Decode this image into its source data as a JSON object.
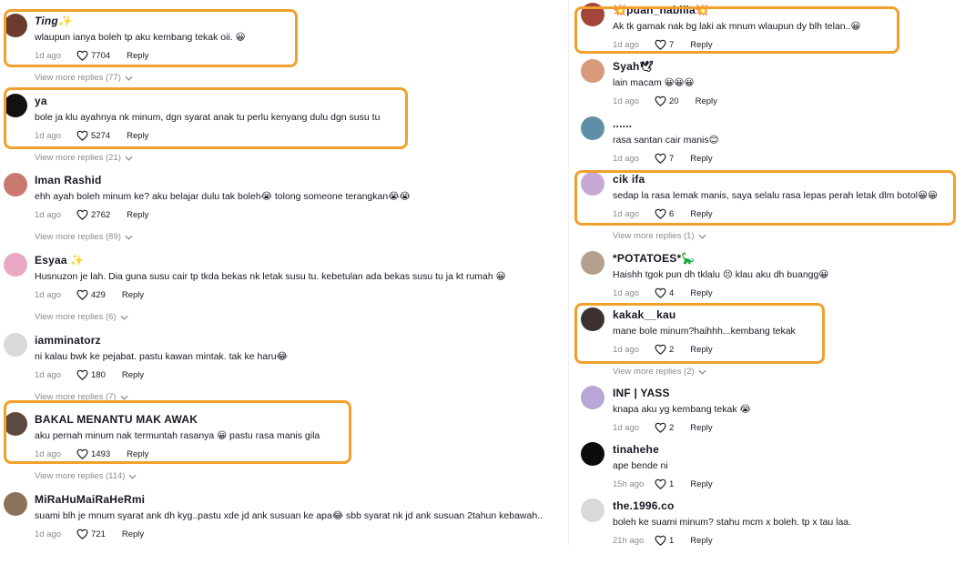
{
  "left": [
    {
      "user": "Ting✨",
      "text": "wlaupun ianya boleh tp aku kembang tekak oii. 😀",
      "time": "1d ago",
      "likes": "7704",
      "reply": "Reply",
      "more": "View more replies (77)",
      "av": "#6b3b2e"
    },
    {
      "user": "ya",
      "text": "bole ja klu ayahnya nk minum, dgn syarat anak tu perlu kenyang dulu dgn susu tu",
      "time": "1d ago",
      "likes": "5274",
      "reply": "Reply",
      "more": "View more replies (21)",
      "av": "#111111"
    },
    {
      "user": "Iman Rashid",
      "text": "ehh ayah boleh minum ke? aku belajar dulu tak boleh😭 tolong someone terangkan😭😭",
      "time": "1d ago",
      "likes": "2762",
      "reply": "Reply",
      "more": "View more replies (89)",
      "av": "#c9796f"
    },
    {
      "user": "Esyaa ✨",
      "text": "Husnuzon je lah. Dia guna susu cair tp tkda bekas nk letak susu tu. kebetulan ada bekas susu tu ja kt rumah 😀",
      "time": "1d ago",
      "likes": "429",
      "reply": "Reply",
      "more": "View more replies (6)",
      "av": "#e9a9c4"
    },
    {
      "user": "iamminatorz",
      "text": "ni kalau bwk ke pejabat. pastu kawan mintak. tak ke haru😂",
      "time": "1d ago",
      "likes": "180",
      "reply": "Reply",
      "more": "View more replies (7)",
      "av": "#d9d9db"
    },
    {
      "user": "BAKAL MENANTU MAK AWAK",
      "text": "aku pernah minum nak termuntah rasanya 😀 pastu rasa manis gila",
      "time": "1d ago",
      "likes": "1493",
      "reply": "Reply",
      "more": "View more replies (114)",
      "av": "#5a4a3f"
    },
    {
      "user": "MiRaHuMaiRaHeRmi",
      "text": "suami blh je mnum syarat ank dh kyg..pastu xde jd ank susuan ke apa😂 sbb syarat nk jd ank susuan 2tahun kebawah..",
      "time": "1d ago",
      "likes": "721",
      "reply": "Reply",
      "more": "",
      "av": "#8a7358"
    }
  ],
  "right": [
    {
      "user": "💥puan_nabilla💥",
      "text": "Ak tk gamak nak bg laki ak mnum wlaupun dy blh telan..😀",
      "time": "1d ago",
      "likes": "7",
      "reply": "Reply",
      "more": "",
      "av": "#a4453a"
    },
    {
      "user": "Syah🕊",
      "text": "lain macam 😀😀😀",
      "time": "1d ago",
      "likes": "20",
      "reply": "Reply",
      "more": "",
      "av": "#d79a7a"
    },
    {
      "user": "......",
      "text": "rasa santan cair manis😊",
      "time": "1d ago",
      "likes": "7",
      "reply": "Reply",
      "more": "",
      "av": "#5f8fa8"
    },
    {
      "user": "cik ifa",
      "text": "sedap la rasa lemak manis, saya selalu rasa lepas perah letak dlm botol😀😀",
      "time": "1d ago",
      "likes": "6",
      "reply": "Reply",
      "more": "View more replies (1)",
      "av": "#c7a9d8"
    },
    {
      "user": "*POTATOES*🦕",
      "text": "Haishh tgok pun dh tklalu 😣 klau aku dh buangg😀",
      "time": "1d ago",
      "likes": "4",
      "reply": "Reply",
      "more": "",
      "av": "#b3a18d"
    },
    {
      "user": "kakak__kau",
      "text": "mane bole minum?haihhh...kembang tekak",
      "time": "1d ago",
      "likes": "2",
      "reply": "Reply",
      "more": "View more replies (2)",
      "av": "#3b3230"
    },
    {
      "user": "INF | YASS",
      "text": "knapa aku yg kembang tekak 😭",
      "time": "1d ago",
      "likes": "2",
      "reply": "Reply",
      "more": "",
      "av": "#b8a6d6"
    },
    {
      "user": "tinahehe",
      "text": "ape bende ni",
      "time": "15h ago",
      "likes": "1",
      "reply": "Reply",
      "more": "",
      "av": "#0c0c0c"
    },
    {
      "user": "the.1996.co",
      "text": "boleh ke suami minum? stahu mcm x boleh. tp x tau laa.",
      "time": "21h ago",
      "likes": "1",
      "reply": "Reply",
      "more": "",
      "av": "#d9d9db"
    }
  ],
  "colors": {
    "highlight": "#f2a02c",
    "muted": "#8a8b91",
    "text": "#161823"
  }
}
